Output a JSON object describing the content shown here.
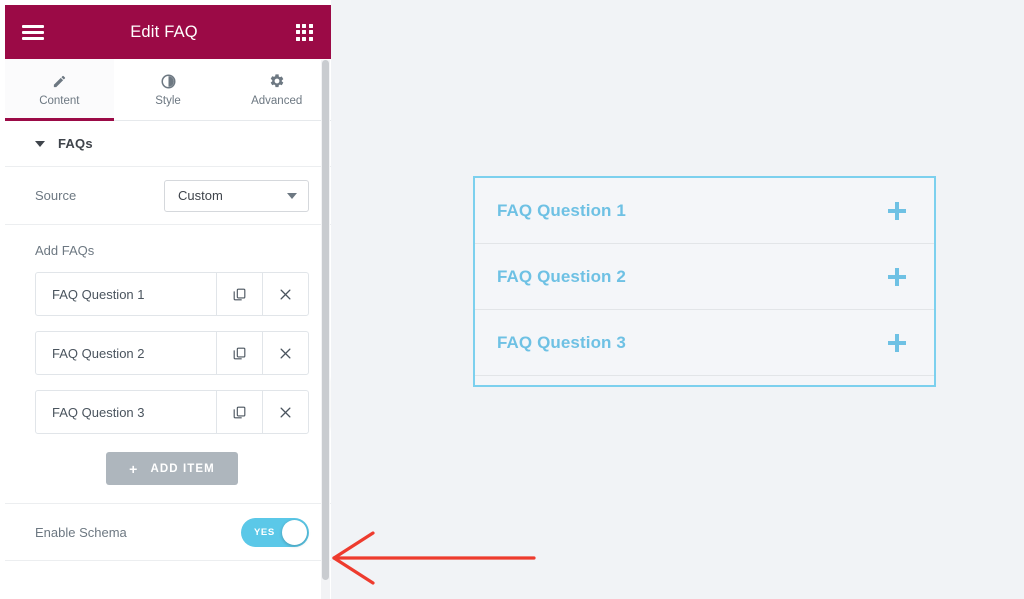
{
  "panel": {
    "header": {
      "title": "Edit FAQ",
      "menu_icon": "hamburger-icon",
      "widgets_icon": "grid-apps-icon"
    },
    "tabs": [
      {
        "label": "Content",
        "icon": "pencil-icon",
        "active": true
      },
      {
        "label": "Style",
        "icon": "contrast-circle-icon",
        "active": false
      },
      {
        "label": "Advanced",
        "icon": "gear-icon",
        "active": false
      }
    ],
    "section": {
      "title": "FAQs",
      "collapsed": false,
      "caret_icon": "caret-down-icon"
    },
    "source_control": {
      "label": "Source",
      "value": "Custom",
      "caret_icon": "chevron-down-icon"
    },
    "repeater": {
      "label": "Add FAQs",
      "items": [
        {
          "title": "FAQ Question 1",
          "duplicate_icon": "copy-icon",
          "remove_icon": "close-x-icon"
        },
        {
          "title": "FAQ Question 2",
          "duplicate_icon": "copy-icon",
          "remove_icon": "close-x-icon"
        },
        {
          "title": "FAQ Question 3",
          "duplicate_icon": "copy-icon",
          "remove_icon": "close-x-icon"
        }
      ],
      "add_button": {
        "plus": "+",
        "label": "ADD ITEM"
      }
    },
    "schema_control": {
      "label": "Enable Schema",
      "switch_state": "YES",
      "switch_on": true
    },
    "collapse_handle_icon": "chevron-left-icon"
  },
  "canvas": {
    "accordion": {
      "items": [
        {
          "title": "FAQ Question 1",
          "toggle_icon": "plus-icon"
        },
        {
          "title": "FAQ Question 2",
          "toggle_icon": "plus-icon"
        },
        {
          "title": "FAQ Question 3",
          "toggle_icon": "plus-icon"
        }
      ]
    },
    "annotation": {
      "shape": "left-arrow",
      "color": "#ee3b2e"
    }
  },
  "colors": {
    "header_bg": "#9b0a46",
    "accent": "#6ec1e4",
    "switch_on": "#5bc8e8",
    "add_button": "#aeb6bd",
    "canvas_bg": "#f1f3f6",
    "annotation": "#ee3b2e"
  }
}
